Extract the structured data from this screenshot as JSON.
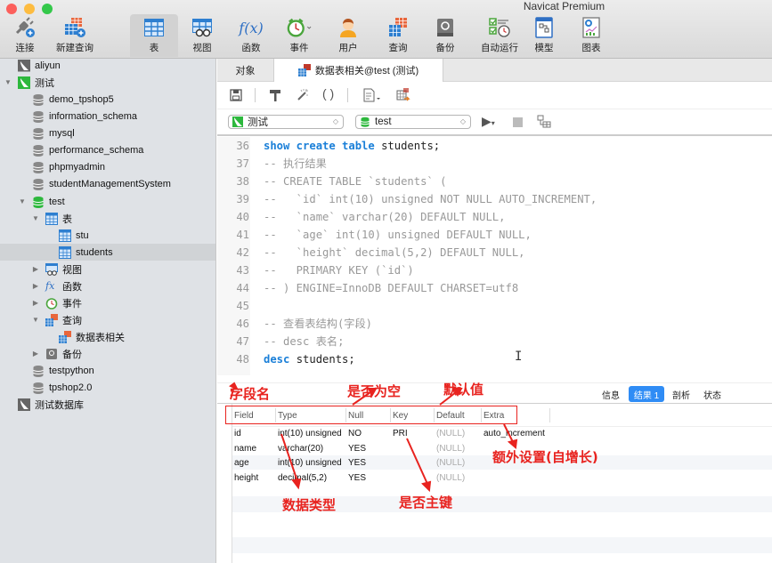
{
  "window": {
    "title": "Navicat Premium",
    "traffic_lights": {
      "close": "#fc605c",
      "minimize": "#fdbc40",
      "zoom": "#34c84a"
    }
  },
  "toolbar": {
    "items": [
      {
        "label": "连接",
        "icon": "plug-icon"
      },
      {
        "label": "新建查询",
        "icon": "new-query-icon"
      },
      {
        "label": "表",
        "icon": "table-icon",
        "active": true
      },
      {
        "label": "视图",
        "icon": "view-icon"
      },
      {
        "label": "函数",
        "icon": "function-icon",
        "glyph": "f(x)"
      },
      {
        "label": "事件",
        "icon": "alarm-clock-icon"
      },
      {
        "label": "用户",
        "icon": "user-icon"
      },
      {
        "label": "查询",
        "icon": "query-icon"
      },
      {
        "label": "备份",
        "icon": "backup-icon"
      },
      {
        "label": "自动运行",
        "icon": "automation-icon"
      },
      {
        "label": "模型",
        "icon": "model-icon"
      },
      {
        "label": "图表",
        "icon": "chart-icon"
      }
    ]
  },
  "sidebar": {
    "items": [
      {
        "label": "aliyun",
        "type": "connection"
      },
      {
        "label": "测试",
        "type": "connection-active",
        "expanded": true
      },
      {
        "label": "demo_tpshop5",
        "type": "database"
      },
      {
        "label": "information_schema",
        "type": "database"
      },
      {
        "label": "mysql",
        "type": "database"
      },
      {
        "label": "performance_schema",
        "type": "database"
      },
      {
        "label": "phpmyadmin",
        "type": "database"
      },
      {
        "label": "studentManagementSystem",
        "type": "database"
      },
      {
        "label": "test",
        "type": "database-open",
        "expanded": true
      },
      {
        "label": "表",
        "type": "tables-folder",
        "expanded": true
      },
      {
        "label": "stu",
        "type": "table"
      },
      {
        "label": "students",
        "type": "table",
        "selected": true
      },
      {
        "label": "视图",
        "type": "views-folder"
      },
      {
        "label": "函数",
        "type": "functions-folder",
        "glyph": "fx"
      },
      {
        "label": "事件",
        "type": "events-folder"
      },
      {
        "label": "查询",
        "type": "queries-folder",
        "expanded": true
      },
      {
        "label": "数据表相关",
        "type": "query"
      },
      {
        "label": "备份",
        "type": "backups-folder"
      },
      {
        "label": "testpython",
        "type": "database"
      },
      {
        "label": "tpshop2.0",
        "type": "database"
      },
      {
        "label": "测试数据库",
        "type": "connection"
      }
    ]
  },
  "tabs": {
    "objects": "对象",
    "query_tab": "数据表相关@test (测试)"
  },
  "query_toolbar": {
    "connection_select": "测试",
    "database_select": "test",
    "run_glyph": "▶",
    "dropdown_glyph": "▾"
  },
  "editor": {
    "lines": [
      {
        "n": "36",
        "kind": "sql",
        "parts": [
          [
            "kw",
            "show create table"
          ],
          [
            "plain",
            " students;"
          ]
        ]
      },
      {
        "n": "37",
        "kind": "comment",
        "text": "-- 执行结果"
      },
      {
        "n": "38",
        "kind": "comment",
        "text": "-- CREATE TABLE `students` ("
      },
      {
        "n": "39",
        "kind": "comment",
        "text": "--   `id` int(10) unsigned NOT NULL AUTO_INCREMENT,"
      },
      {
        "n": "40",
        "kind": "comment",
        "text": "--   `name` varchar(20) DEFAULT NULL,"
      },
      {
        "n": "41",
        "kind": "comment",
        "text": "--   `age` int(10) unsigned DEFAULT NULL,"
      },
      {
        "n": "42",
        "kind": "comment",
        "text": "--   `height` decimal(5,2) DEFAULT NULL,"
      },
      {
        "n": "43",
        "kind": "comment",
        "text": "--   PRIMARY KEY (`id`)"
      },
      {
        "n": "44",
        "kind": "comment",
        "text": "-- ) ENGINE=InnoDB DEFAULT CHARSET=utf8"
      },
      {
        "n": "45",
        "kind": "comment",
        "text": ""
      },
      {
        "n": "46",
        "kind": "comment",
        "text": "-- 查看表结构(字段)"
      },
      {
        "n": "47",
        "kind": "comment",
        "text": "-- desc 表名;"
      },
      {
        "n": "48",
        "kind": "sql",
        "parts": [
          [
            "kw",
            "desc"
          ],
          [
            "plain",
            " students;"
          ]
        ]
      }
    ]
  },
  "result_tabs": {
    "items": [
      "信息",
      "结果 1",
      "剖析",
      "状态"
    ],
    "active": "结果 1",
    "active_color": "#2f8cf5"
  },
  "result_grid": {
    "columns": [
      "Field",
      "Type",
      "Null",
      "Key",
      "Default",
      "Extra"
    ],
    "rows": [
      [
        "id",
        "int(10) unsigned",
        "NO",
        "PRI",
        "(NULL)",
        "auto_increment"
      ],
      [
        "name",
        "varchar(20)",
        "YES",
        "",
        "(NULL)",
        ""
      ],
      [
        "age",
        "int(10) unsigned",
        "YES",
        "",
        "(NULL)",
        ""
      ],
      [
        "height",
        "decimal(5,2)",
        "YES",
        "",
        "(NULL)",
        ""
      ]
    ]
  },
  "annotations": {
    "color": "#e8231f",
    "field_name": "字段名",
    "is_null": "是否为空",
    "default_value": "默认值",
    "data_type": "数据类型",
    "primary_key": "是否主键",
    "extra": "额外设置(自增长)"
  }
}
